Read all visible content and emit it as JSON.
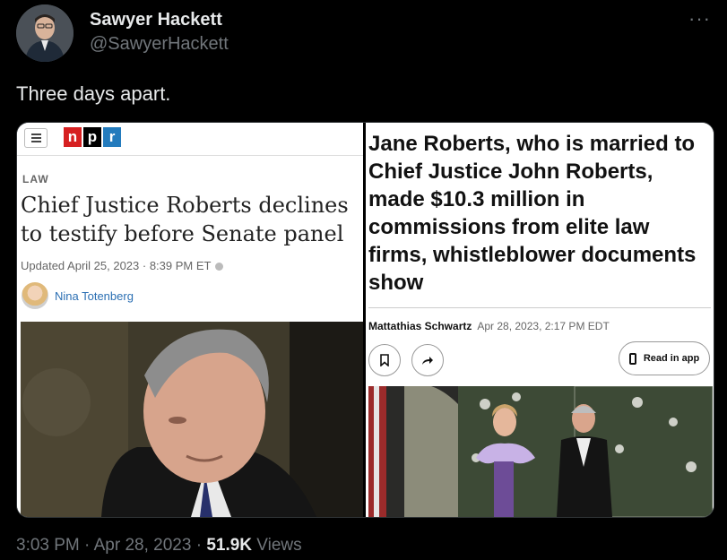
{
  "tweet": {
    "author_name": "Sawyer Hackett",
    "author_handle": "@SawyerHackett",
    "more_icon": "more-horizontal-icon",
    "text": "Three days apart.",
    "time": "3:03 PM",
    "date": "Apr 28, 2023",
    "separator": "·",
    "views_count": "51.9K",
    "views_label": "Views"
  },
  "npr": {
    "logo_letters": [
      "n",
      "p",
      "r"
    ],
    "logo_colors": [
      "#d62021",
      "#000000",
      "#237bbd"
    ],
    "section": "LAW",
    "headline": "Chief Justice Roberts declines to testify before Senate panel",
    "updated": "Updated April 25, 2023 · 8:39 PM ET",
    "author": "Nina Totenberg"
  },
  "wsj": {
    "headline": "Jane Roberts, who is married to Chief Justice John Roberts, made $10.3 million in commissions from elite law firms, whistleblower documents show",
    "author": "Mattathias Schwartz",
    "date": "Apr 28, 2023, 2:17 PM EDT",
    "read_in_app": "Read in app"
  }
}
